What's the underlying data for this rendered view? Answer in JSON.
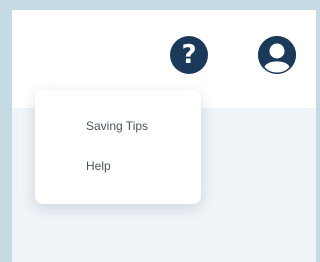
{
  "header": {
    "icons": {
      "help": "question-mark-icon",
      "help_glyph": "?",
      "profile": "user-profile-icon"
    },
    "accent_color": "#1b3a5a"
  },
  "dropdown_menu": {
    "items": [
      {
        "label": "Saving Tips"
      },
      {
        "label": "Help"
      }
    ]
  },
  "colors": {
    "frame": "#c5dbe3",
    "content_background": "#eef4f8",
    "header_background": "#ffffff",
    "menu_text": "#4a5560"
  }
}
